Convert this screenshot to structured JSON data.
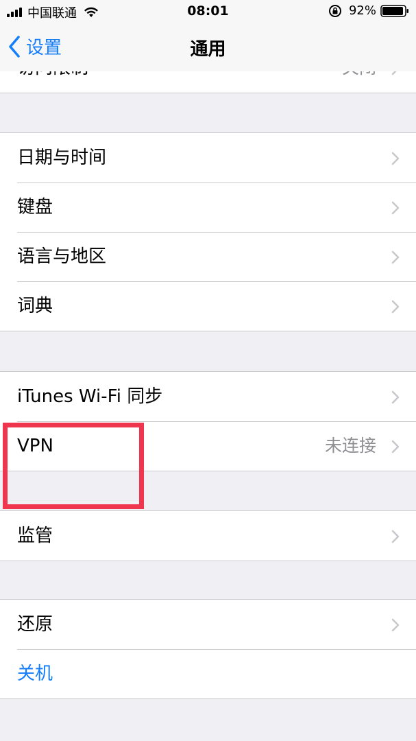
{
  "status_bar": {
    "carrier": "中国联通",
    "time": "08:01",
    "battery": "92%",
    "icons": [
      "signal-icon",
      "wifi-icon",
      "orientation-lock-icon",
      "battery-icon"
    ]
  },
  "nav": {
    "back_label": "设置",
    "title": "通用"
  },
  "groups": [
    {
      "rows": [
        {
          "label": "访问限制",
          "value": "关闭"
        }
      ]
    },
    {
      "rows": [
        {
          "label": "日期与时间"
        },
        {
          "label": "键盘"
        },
        {
          "label": "语言与地区"
        },
        {
          "label": "词典"
        }
      ]
    },
    {
      "rows": [
        {
          "label": "iTunes Wi-Fi 同步"
        },
        {
          "label": "VPN",
          "value": "未连接"
        }
      ]
    },
    {
      "rows": [
        {
          "label": "监管"
        }
      ]
    },
    {
      "rows": [
        {
          "label": "还原"
        },
        {
          "label": "关机"
        }
      ]
    }
  ],
  "colors": {
    "accent": "#157efb",
    "highlight": "#f0354f",
    "background": "#efeff4",
    "secondary_text": "#8e8e93"
  }
}
